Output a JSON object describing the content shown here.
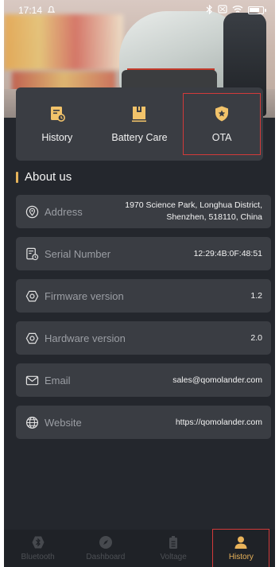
{
  "status_bar": {
    "time": "17:14"
  },
  "quick_actions": [
    {
      "label": "History",
      "icon": "history-document-icon"
    },
    {
      "label": "Battery Care",
      "icon": "battery-care-icon"
    },
    {
      "label": "OTA",
      "icon": "ota-shield-star-icon"
    }
  ],
  "section": {
    "title": "About us"
  },
  "info_rows": [
    {
      "label": "Address",
      "value_line1": "1970 Science Park, Longhua District,",
      "value_line2": "Shenzhen, 518110, China",
      "icon": "location-icon"
    },
    {
      "label": "Serial Number",
      "value": "12:29:4B:0F:48:51",
      "icon": "serial-document-icon"
    },
    {
      "label": "Firmware version",
      "value": "1.2",
      "icon": "firmware-hexagon-icon"
    },
    {
      "label": "Hardware version",
      "value": "2.0",
      "icon": "hardware-hexagon-icon"
    },
    {
      "label": "Email",
      "value": "sales@qomolander.com",
      "icon": "email-envelope-icon"
    },
    {
      "label": "Website",
      "value": "https://qomolander.com",
      "icon": "globe-icon"
    }
  ],
  "bottom_nav": [
    {
      "label": "Bluetooth",
      "icon": "bluetooth-icon"
    },
    {
      "label": "Dashboard",
      "icon": "dashboard-compass-icon"
    },
    {
      "label": "Voltage",
      "icon": "voltage-battery-icon"
    },
    {
      "label": "History",
      "icon": "user-profile-icon",
      "active": true
    }
  ],
  "colors": {
    "accent": "#e9b35a",
    "background": "#24272d",
    "card": "#3a3d43",
    "highlight_outline": "#d23a3a"
  },
  "battery_level": 0.8
}
